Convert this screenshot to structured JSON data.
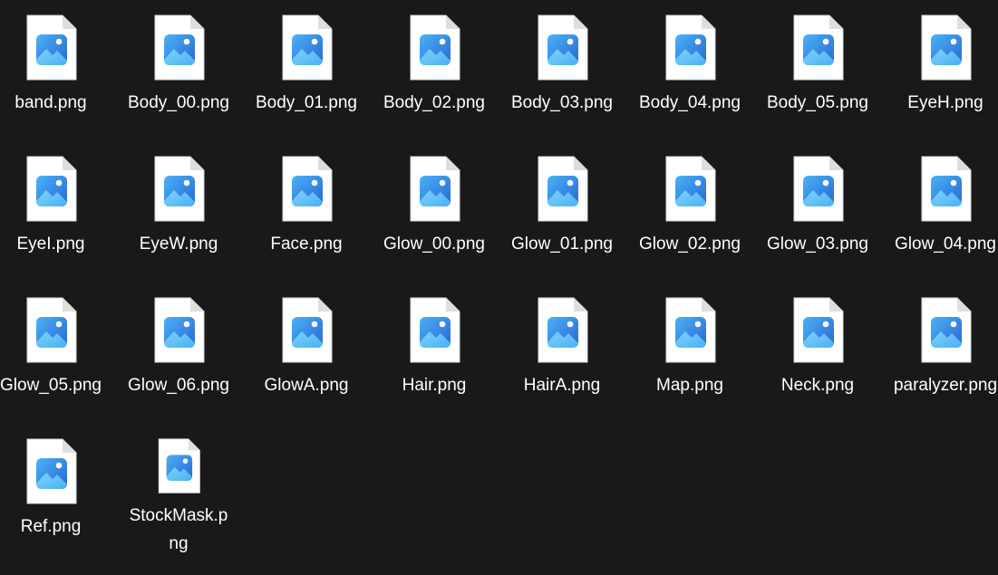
{
  "view": {
    "icon_name": "image-file-icon",
    "files": [
      {
        "name": "band.png"
      },
      {
        "name": "Body_00.png"
      },
      {
        "name": "Body_01.png"
      },
      {
        "name": "Body_02.png"
      },
      {
        "name": "Body_03.png"
      },
      {
        "name": "Body_04.png"
      },
      {
        "name": "Body_05.png"
      },
      {
        "name": "EyeH.png"
      },
      {
        "name": "EyeI.png"
      },
      {
        "name": "EyeW.png"
      },
      {
        "name": "Face.png"
      },
      {
        "name": "Glow_00.png"
      },
      {
        "name": "Glow_01.png"
      },
      {
        "name": "Glow_02.png"
      },
      {
        "name": "Glow_03.png"
      },
      {
        "name": "Glow_04.png"
      },
      {
        "name": "Glow_05.png"
      },
      {
        "name": "Glow_06.png"
      },
      {
        "name": "GlowA.png"
      },
      {
        "name": "Hair.png"
      },
      {
        "name": "HairA.png"
      },
      {
        "name": "Map.png"
      },
      {
        "name": "Neck.png"
      },
      {
        "name": "paralyzer.png"
      },
      {
        "name": "Ref.png"
      },
      {
        "name": "StockMask.png"
      }
    ]
  },
  "colors": {
    "background": "#191919",
    "text": "#ffffff",
    "icon_gradient_start": "#56b6f5",
    "icon_gradient_end": "#2f6fe0"
  }
}
